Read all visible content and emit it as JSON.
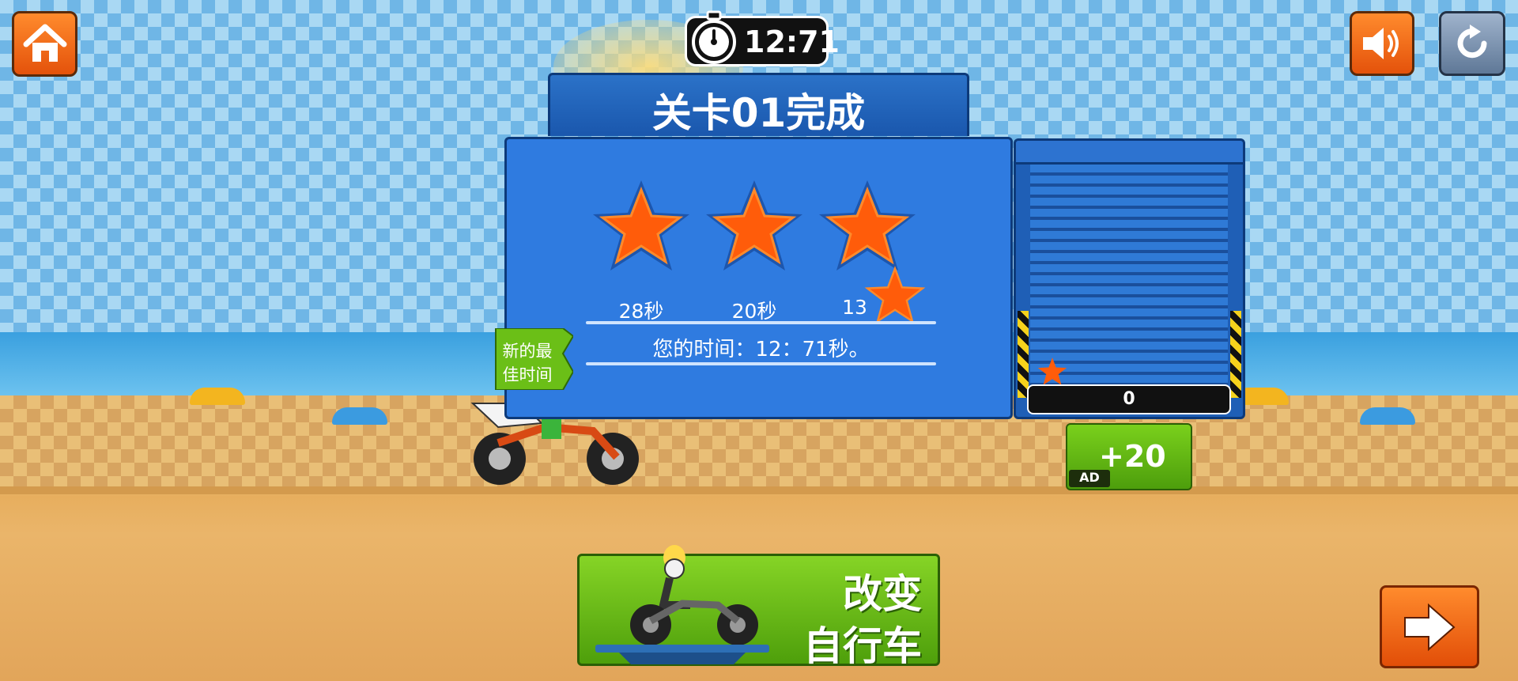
{
  "hud": {
    "timer": "12:71",
    "icons": {
      "home": "home-icon",
      "sound": "speaker-icon",
      "restart": "restart-icon",
      "stopwatch": "stopwatch-icon"
    }
  },
  "result": {
    "title": "关卡01完成",
    "stars": [
      {
        "label": "28秒",
        "earned": true
      },
      {
        "label": "20秒",
        "earned": true
      },
      {
        "label": "13",
        "earned": true
      }
    ],
    "your_time": "您的时间：12：71秒。",
    "best_badge": {
      "line1": "新的最",
      "line2": "佳时间"
    }
  },
  "garage": {
    "coins": "0"
  },
  "ad_button": {
    "reward": "+20",
    "tag": "AD"
  },
  "change_bike_button": {
    "line1": "改变",
    "line2": "自行车"
  },
  "colors": {
    "panel_blue": "#2f7be0",
    "accent_orange": "#ff6a12",
    "accent_green": "#6bbf17"
  }
}
